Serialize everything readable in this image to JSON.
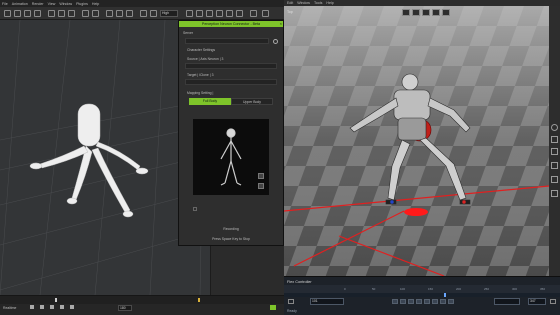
{
  "left_app": {
    "menu": [
      "File",
      "Animation",
      "Render",
      "View",
      "Window",
      "Plugins",
      "Help"
    ],
    "toolbar_dropdown": "High",
    "bottom": {
      "timeline_label": "Realtime",
      "frame_field": "180"
    }
  },
  "dialog": {
    "title": "Perception Neuron Connector - Beta",
    "close_glyph": "×",
    "server_label": "Server",
    "character_settings_label": "Character Settings",
    "source_label": "Source | Axis Neuron | 3",
    "target_label": "Target | iClone | 3",
    "mapping_label": "Mapping Setting |",
    "tab_full_body": "Full Body",
    "tab_upper_body": "Upper Body",
    "recording_label": "Recording",
    "stop_hint": "Press Space Key to Stop",
    "accent_color": "#7ec42a"
  },
  "right_app": {
    "menu": [
      "Edit",
      "Window",
      "Tools",
      "Help"
    ],
    "view_label": "Top",
    "flex_panel": {
      "title": "Flex Controller",
      "frame_field": "101",
      "end_field": "347",
      "ruler": [
        "0",
        "50",
        "100",
        "150",
        "200",
        "250",
        "300",
        "350"
      ],
      "status": "Ready"
    }
  }
}
